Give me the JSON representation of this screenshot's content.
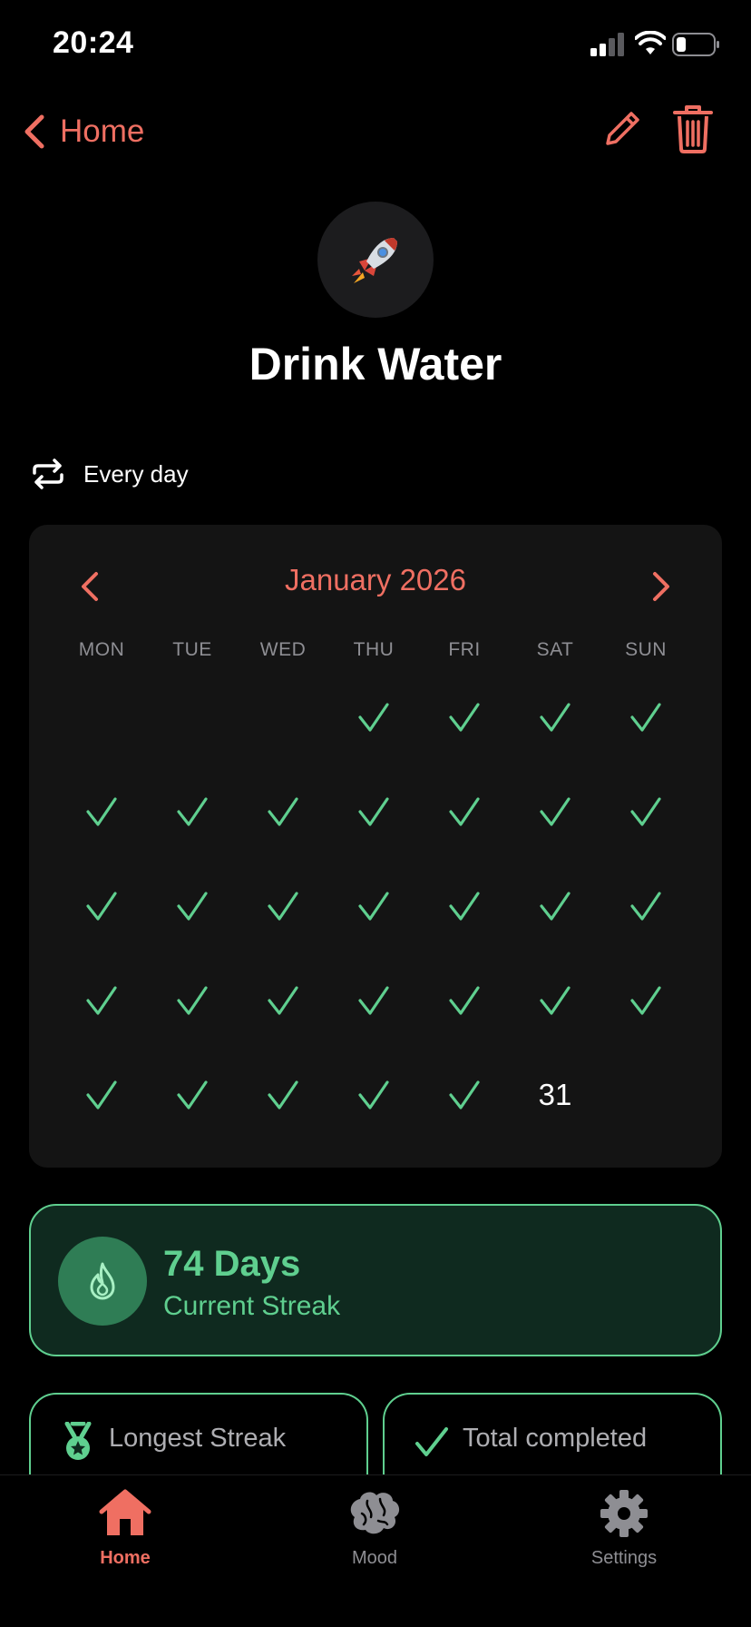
{
  "status_bar": {
    "time": "20:24"
  },
  "nav": {
    "back_label": "Home"
  },
  "habit": {
    "icon": "rocket-icon",
    "emoji": "🚀",
    "title": "Drink Water",
    "frequency": "Every day"
  },
  "calendar": {
    "month": "January 2026",
    "weekdays": [
      "MON",
      "TUE",
      "WED",
      "THU",
      "FRI",
      "SAT",
      "SUN"
    ],
    "leading_blank_days": 3,
    "completed_through_day": 30,
    "days_in_month": 31,
    "today": "31"
  },
  "streak": {
    "value": "74 Days",
    "label": "Current Streak"
  },
  "stats": {
    "longest_label": "Longest Streak",
    "total_label": "Total completed"
  },
  "tabs": [
    {
      "label": "Home",
      "icon": "house-icon",
      "active": true
    },
    {
      "label": "Mood",
      "icon": "brain-icon",
      "active": false
    },
    {
      "label": "Settings",
      "icon": "gear-icon",
      "active": false
    }
  ],
  "colors": {
    "accent": "#ef6f62",
    "success": "#5fcf8f",
    "card": "#141414",
    "streak_bg": "#0f2a1f",
    "streak_badge": "#2f7d55"
  }
}
